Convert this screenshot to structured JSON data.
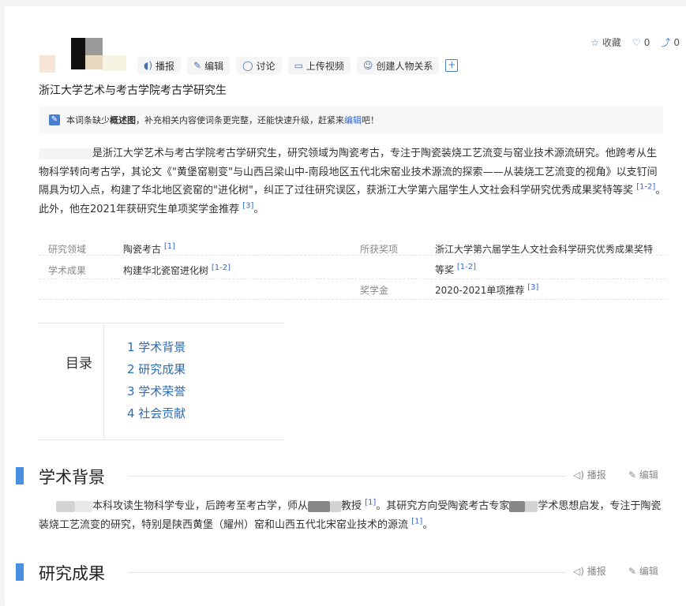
{
  "toolbar": {
    "items": [
      "播报",
      "编辑",
      "讨论",
      "上传视频",
      "创建人物关系"
    ]
  },
  "actions": {
    "collect": "收藏",
    "like_count": "0",
    "share_count": "0"
  },
  "subtitle": "浙江大学艺术与考古学院考古学研究生",
  "notice": {
    "prefix": "本词条缺少",
    "bold": "概述图",
    "middle": "，补充相关内容使词条更完整，还能快速升级，赶紧来",
    "link": "编辑",
    "suffix": "吧！"
  },
  "summary": {
    "text1": "是浙江大学艺术与考古学院考古学研究生，研究领域为陶瓷考古，专注于陶瓷装烧工艺流变与窑业技术源流研究。他跨考从生物科学转向考古学，其论文《\"黄堡窑剔变\"与山西吕梁山中-南段地区五代北宋窑业技术源流的探索——从装烧工艺流变的视角》以支钉间隔具为切入点，构建了华北地区瓷窑的\"进化树\"，纠正了过往研究误区，获浙江大学第六届学生人文社会科学研究优秀成果奖特等奖",
    "ref1": "[1-2]",
    "text2": "。此外，他在2021年获研究生单项奖学金推荐",
    "ref2": "[3]",
    "text3": "。"
  },
  "info": {
    "field_label": "研究领域",
    "field_value": "陶瓷考古",
    "field_ref": "[1]",
    "achieve_label": "学术成果",
    "achieve_value": "构建华北瓷窑进化树",
    "achieve_ref": "[1-2]",
    "award_label": "所获奖项",
    "award_value_line1": "浙江大学第六届学生人文社会科学研究优秀成果奖特",
    "award_value_line2": "等奖",
    "award_ref": "[1-2]",
    "scholar_label": "奖学金",
    "scholar_value": "2020-2021单项推荐",
    "scholar_ref": "[3]"
  },
  "toc": {
    "title": "目录",
    "items": [
      "1  学术背景",
      "2  研究成果",
      "3  学术荣誉",
      "4  社会贡献"
    ]
  },
  "sections": [
    {
      "title": "学术背景",
      "play": "播报",
      "edit": "编辑"
    },
    {
      "title": "研究成果",
      "play": "播报",
      "edit": "编辑"
    }
  ],
  "background": {
    "t1": "本科攻读生物科学专业，后跨考至考古学，师从",
    "t2": "教授",
    "ref1": "[1]",
    "t3": "。其研究方向受陶瓷考古专家",
    "t4": "学术思想启发，专注于陶瓷装烧工艺流变的研究，特别是陕西黄堡（耀州）窑和山西五代北宋窑业技术的源流",
    "ref2": "[1]",
    "t5": "。"
  }
}
